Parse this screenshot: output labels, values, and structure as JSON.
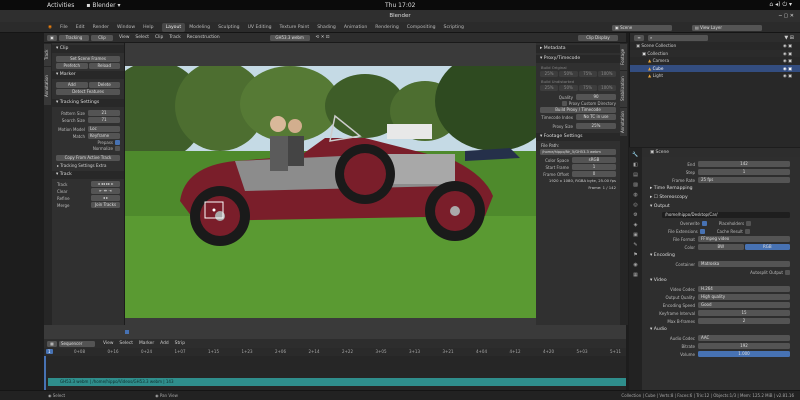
{
  "gnome": {
    "activities": "Activities",
    "app": "Blender",
    "clock": "Thu 17:02"
  },
  "window_title": "Blender",
  "menu": [
    "File",
    "Edit",
    "Render",
    "Window",
    "Help"
  ],
  "workspaces": [
    "Layout",
    "Modeling",
    "Sculpting",
    "UV Editing",
    "Texture Paint",
    "Shading",
    "Animation",
    "Rendering",
    "Compositing",
    "Scripting"
  ],
  "scene": "Scene",
  "view_layer": "View Layer",
  "clip_header": {
    "mode": "Tracking",
    "view": "Clip",
    "menus": [
      "View",
      "Select",
      "Clip",
      "Track",
      "Reconstruction"
    ],
    "clip_name": "GH53.3 webm",
    "display": "Clip Display"
  },
  "left_tabs": [
    "Track",
    "Annotation"
  ],
  "left_panel": {
    "clip": {
      "title": "Clip",
      "set_scene_frames": "Set Scene Frames",
      "prefetch": "Prefetch",
      "reload": "Reload"
    },
    "marker": {
      "title": "Marker",
      "add": "Add",
      "delete": "Delete",
      "detect": "Detect Features"
    },
    "settings": {
      "title": "Tracking Settings",
      "pattern_label": "Pattern Size",
      "pattern_value": "21",
      "search_label": "Search Size",
      "search_value": "71",
      "motion_label": "Motion Model",
      "motion_value": "Loc",
      "match_label": "Match",
      "match_value": "Keyframe",
      "prepass": "Prepass",
      "normalize": "Normalize",
      "copy": "Copy From Active Track",
      "extra": "Tracking Settings Extra"
    },
    "track": {
      "title": "Track",
      "rows": [
        "Track",
        "Clear",
        "Refine",
        "Merge"
      ],
      "join": "Join Tracks"
    }
  },
  "right_panel": {
    "metadata": "Metadata",
    "proxy": {
      "title": "Proxy/Timecode",
      "build_original": "Build Original",
      "sizes": [
        "25%",
        "50%",
        "75%",
        "100%"
      ],
      "build_undistorted": "Build Undistorted",
      "quality_label": "Quality",
      "quality_value": "90",
      "custom_dir": "Proxy Custom Directory",
      "build_btn": "Build Proxy / Timecode",
      "timecode_label": "Timecode Index",
      "timecode_value": "No TC in use",
      "proxy_size_label": "Proxy Size",
      "proxy_size_value": "25%"
    },
    "footage": {
      "title": "Footage Settings",
      "file_path_label": "File Path:",
      "file_path": "/home/hippo/Nr_5/GH53.3 webm",
      "color_space_label": "Color Space",
      "color_space": "sRGB",
      "start_frame_label": "Start Frame",
      "start_frame": "1",
      "frame_offset_label": "Frame Offset",
      "frame_offset": "0",
      "info": "1920 x 1080, RGBA byte, 25.00 fps",
      "frame": "Frame: 1 / 142"
    }
  },
  "right_tabs": [
    "Footage",
    "Stabilization",
    "Annotation"
  ],
  "outliner": {
    "items": [
      {
        "name": "Scene Collection",
        "depth": 0
      },
      {
        "name": "Collection",
        "depth": 1
      },
      {
        "name": "Camera",
        "depth": 2
      },
      {
        "name": "Cube",
        "depth": 2,
        "selected": true
      },
      {
        "name": "Light",
        "depth": 2
      }
    ]
  },
  "props": {
    "scene": "Scene",
    "end_label": "End",
    "end": "142",
    "step_label": "Step",
    "step": "1",
    "rate_label": "Frame Rate",
    "rate": "25 fps",
    "time_remapping": "Time Remapping",
    "stereoscopy": "Stereoscopy",
    "output": "Output",
    "output_path": "/home/hippo/Desktop/Car/",
    "overwrite": "Overwrite",
    "placeholders": "Placeholders",
    "file_ext": "File Extensions",
    "cache": "Cache Result",
    "file_format_label": "File Format",
    "file_format": "FFmpeg video",
    "color_label": "Color",
    "bw": "BW",
    "rgb": "RGB",
    "encoding": "Encoding",
    "container_label": "Container",
    "container": "Matroska",
    "autosplit": "Autosplit Output",
    "video": "Video",
    "codec_label": "Video Codec",
    "codec": "H.264",
    "quality_label": "Output Quality",
    "quality": "High quality",
    "speed_label": "Encoding Speed",
    "speed": "Good",
    "keyframe_label": "Keyframe Interval",
    "keyframe": "15",
    "bframes_label": "Max B-frames",
    "bframes": "2",
    "audio": "Audio",
    "acodec_label": "Audio Codec",
    "acodec": "AAC",
    "bitrate_label": "Bitrate",
    "bitrate": "192",
    "volume_label": "Volume",
    "volume": "1.000"
  },
  "sequencer": {
    "mode": "Sequencer",
    "menus": [
      "View",
      "Select",
      "Marker",
      "Add",
      "Strip"
    ],
    "current": "1",
    "ticks": [
      "0+08",
      "0+16",
      "0+24",
      "1+07",
      "1+15",
      "1+23",
      "2+06",
      "2+14",
      "2+22",
      "3+05",
      "3+13",
      "3+21",
      "4+04",
      "4+12",
      "4+20",
      "5+03",
      "5+11"
    ],
    "strip": "GH53.3 webm | /home/hippo/Videos/GH53.3 webm | 143"
  },
  "status": {
    "left": "Select",
    "mid": "Pan View",
    "right": "Collection | Cube | Verts:8 | Faces:6 | Tris:12 | Objects:1/3 | Mem: 125.2 MiB | v2.81.16"
  }
}
